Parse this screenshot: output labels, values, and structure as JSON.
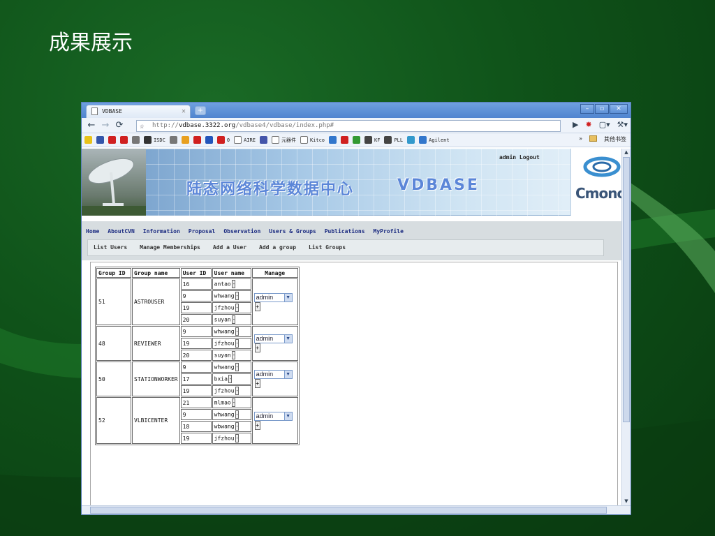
{
  "slide": {
    "title": "成果展示"
  },
  "browser": {
    "tab_title": "VDBASE",
    "url_prefix": "http://",
    "url_host": "vdbase.3322.org",
    "url_path": "/vdbase4/vdbase/index.php#",
    "bookmarks": [
      {
        "label": "",
        "icon": "smile-icon",
        "color": "#e8c21a"
      },
      {
        "label": "",
        "icon": "app-icon",
        "color": "#3355aa"
      },
      {
        "label": "",
        "icon": "opera-icon",
        "color": "#d02020"
      },
      {
        "label": "",
        "icon": "s-icon",
        "color": "#d02020"
      },
      {
        "label": "",
        "icon": "bracket-icon",
        "color": "#777777"
      },
      {
        "label": "ISDC",
        "icon": "globe-icon",
        "color": "#333333"
      },
      {
        "label": "",
        "icon": "box-icon",
        "color": "#777777"
      },
      {
        "label": "",
        "icon": "brush-icon",
        "color": "#e8a020"
      },
      {
        "label": "",
        "icon": "tool-icon",
        "color": "#d02020"
      },
      {
        "label": "",
        "icon": "calendar-icon",
        "color": "#2255bb"
      },
      {
        "label": "0",
        "icon": "tool-icon",
        "color": "#d02020"
      },
      {
        "label": "AIRE",
        "icon": "page-icon",
        "color": "#ffffff"
      },
      {
        "label": "",
        "icon": "globe-icon",
        "color": "#4455aa"
      },
      {
        "label": "元器件",
        "icon": "page-icon",
        "color": "#ffffff"
      },
      {
        "label": "Kitco",
        "icon": "page-icon",
        "color": "#ffffff"
      },
      {
        "label": "",
        "icon": "eye-icon",
        "color": "#3377cc"
      },
      {
        "label": "",
        "icon": "bug-icon",
        "color": "#d02020"
      },
      {
        "label": "",
        "icon": "puzzle-icon",
        "color": "#339933"
      },
      {
        "label": "KF",
        "icon": "wiki-icon",
        "color": "#444444"
      },
      {
        "label": "PLL",
        "icon": "wiki-icon",
        "color": "#444444"
      },
      {
        "label": "",
        "icon": "diamond-icon",
        "color": "#3399cc"
      },
      {
        "label": "Agilent",
        "icon": "star-icon",
        "color": "#3377cc"
      }
    ],
    "other_bookmarks": "其他书签",
    "chevron": "»"
  },
  "page": {
    "admin_logout": "admin Logout",
    "banner_title": "陆态网络科学数据中心",
    "banner_brand": "VDBASE",
    "logo_text": "Cmonoc",
    "menu": [
      "Home",
      "AboutCVN",
      "Information",
      "Proposal",
      "Observation",
      "Users & Groups",
      "Publications",
      "MyProfile"
    ],
    "submenu": [
      "List Users",
      "Manage Memberships",
      "Add a User",
      "Add a group",
      "List Groups"
    ],
    "table": {
      "headers": [
        "Group ID",
        "Group name",
        "User ID",
        "User name",
        "Manage"
      ],
      "groups": [
        {
          "id": "51",
          "name": "ASTROUSER",
          "manage": "admin",
          "users": [
            {
              "uid": "16",
              "uname": "antao"
            },
            {
              "uid": "9",
              "uname": "whwang"
            },
            {
              "uid": "19",
              "uname": "jfzhou"
            },
            {
              "uid": "20",
              "uname": "suyan"
            }
          ]
        },
        {
          "id": "48",
          "name": "REVIEWER",
          "manage": "admin",
          "users": [
            {
              "uid": "9",
              "uname": "whwang"
            },
            {
              "uid": "19",
              "uname": "jfzhou"
            },
            {
              "uid": "20",
              "uname": "suyan"
            }
          ]
        },
        {
          "id": "50",
          "name": "STATIONWORKER",
          "manage": "admin",
          "users": [
            {
              "uid": "9",
              "uname": "whwang"
            },
            {
              "uid": "17",
              "uname": "bxia"
            },
            {
              "uid": "19",
              "uname": "jfzhou"
            }
          ]
        },
        {
          "id": "52",
          "name": "VLBICENTER",
          "manage": "admin",
          "users": [
            {
              "uid": "21",
              "uname": "mlmao"
            },
            {
              "uid": "9",
              "uname": "whwang"
            },
            {
              "uid": "18",
              "uname": "wbwang"
            },
            {
              "uid": "19",
              "uname": "jfzhou"
            }
          ]
        }
      ],
      "minus": "-",
      "plus": "+"
    }
  }
}
